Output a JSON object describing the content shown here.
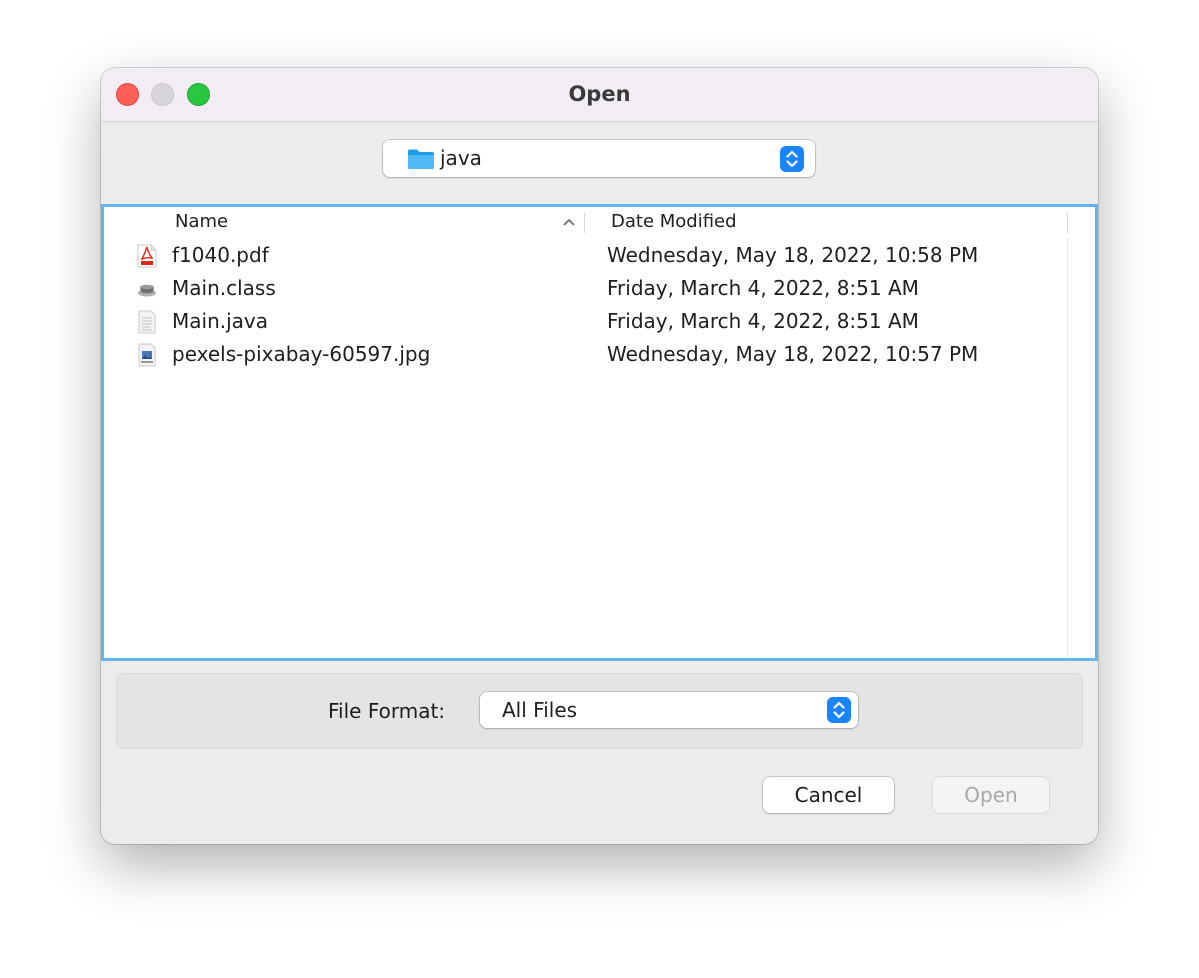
{
  "window": {
    "title": "Open"
  },
  "path_popup": {
    "folder_icon": "folder-icon",
    "label": "java"
  },
  "file_list": {
    "columns": {
      "name": "Name",
      "date_modified": "Date Modified"
    },
    "sort": "ascending",
    "files": [
      {
        "icon": "pdf-icon",
        "name": "f1040.pdf",
        "date_modified": "Wednesday, May 18, 2022, 10:58 PM"
      },
      {
        "icon": "java-class-icon",
        "name": "Main.class",
        "date_modified": "Friday, March 4, 2022, 8:51 AM"
      },
      {
        "icon": "text-document-icon",
        "name": "Main.java",
        "date_modified": "Friday, March 4, 2022, 8:51 AM"
      },
      {
        "icon": "image-file-icon",
        "name": "pexels-pixabay-60597.jpg",
        "date_modified": "Wednesday, May 18, 2022, 10:57 PM"
      }
    ]
  },
  "file_format": {
    "label": "File Format:",
    "value": "All Files"
  },
  "buttons": {
    "cancel": "Cancel",
    "open": "Open"
  },
  "colors": {
    "accent": "#1a84ff",
    "focus_ring": "#63b4ef",
    "close": "#fe5f57",
    "zoom": "#2ac840"
  }
}
